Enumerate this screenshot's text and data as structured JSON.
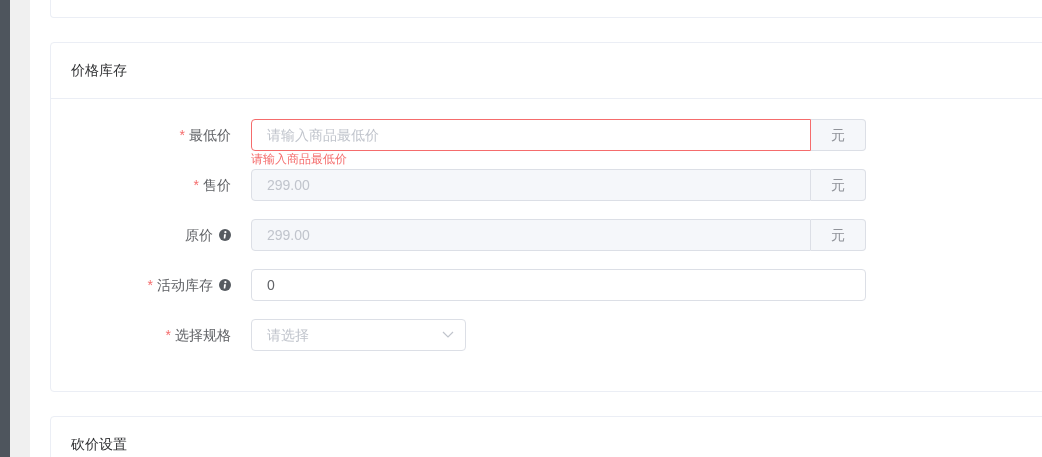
{
  "sections": [
    {
      "title": "价格库存",
      "rows": [
        {
          "label": "最低价",
          "required_mark": "*",
          "info": false,
          "field": {
            "kind": "input",
            "placeholder": "请输入商品最低价",
            "disabled": false,
            "invalid": true,
            "suffix": "元"
          },
          "error": "请输入商品最低价"
        },
        {
          "label": "售价",
          "required_mark": "*",
          "info": false,
          "field": {
            "kind": "input",
            "value": "299.00",
            "disabled": true,
            "invalid": false,
            "suffix": "元"
          }
        },
        {
          "label": "原价",
          "info": true,
          "field": {
            "kind": "input",
            "value": "299.00",
            "disabled": true,
            "invalid": false,
            "suffix": "元"
          }
        },
        {
          "label": "活动库存",
          "required_mark": "*",
          "info": true,
          "field": {
            "kind": "input",
            "value": "0",
            "disabled": false,
            "invalid": false
          }
        },
        {
          "label": "选择规格",
          "required_mark": "*",
          "info": false,
          "field": {
            "kind": "select",
            "placeholder": "请选择",
            "invalid": false
          }
        }
      ]
    },
    {
      "title": "砍价设置"
    }
  ]
}
